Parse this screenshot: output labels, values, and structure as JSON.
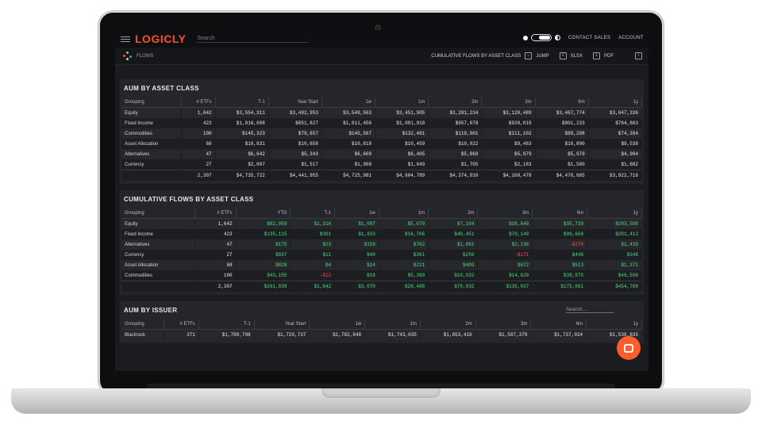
{
  "app": {
    "logo": "LOGICLY",
    "search_placeholder": "Search"
  },
  "topbar": {
    "contact_sales": "CONTACT SALES",
    "account": "ACCOUNT"
  },
  "subbar": {
    "page": "FLOWS",
    "section_select": "CUMULATIVE FLOWS BY ASSET CLASS",
    "jump": "JUMP",
    "xlsx": "XLSX",
    "pdf": "PDF"
  },
  "colors": {
    "accent": "#ff4d2a",
    "positive": "#4ee07b",
    "negative": "#ff4d4d"
  },
  "aum_asset": {
    "title": "AUM BY ASSET CLASS",
    "headers": [
      "Grouping",
      "# ETFs",
      "T-1",
      "Year Start",
      "1w",
      "1m",
      "2m",
      "3m",
      "6m",
      "1y"
    ],
    "rows": [
      [
        "Equity",
        "1,642",
        "$3,554,311",
        "$3,492,953",
        "$3,549,563",
        "$3,451,905",
        "$3,281,234",
        "$3,120,489",
        "$3,467,774",
        "$3,047,336"
      ],
      [
        "Fixed Income",
        "423",
        "$1,016,608",
        "$851,827",
        "$1,011,456",
        "$1,001,910",
        "$957,078",
        "$920,019",
        "$901,233",
        "$784,863"
      ],
      [
        "Commodities",
        "100",
        "$145,323",
        "$79,657",
        "$145,567",
        "$132,461",
        "$119,001",
        "$111,102",
        "$89,298",
        "$74,394"
      ],
      [
        "Asset Allocation",
        "68",
        "$10,831",
        "$10,658",
        "$10,818",
        "$10,459",
        "$10,022",
        "$9,463",
        "$10,800",
        "$9,538"
      ],
      [
        "Alternatives",
        "47",
        "$6,642",
        "$5,343",
        "$6,608",
        "$6,405",
        "$5,869",
        "$5,979",
        "$5,979",
        "$4,904"
      ],
      [
        "Currency",
        "27",
        "$2,007",
        "$1,517",
        "$1,968",
        "$1,649",
        "$1,705",
        "$2,183",
        "$1,580",
        "$1,682"
      ]
    ],
    "total": [
      "",
      "2,307",
      "$4,735,722",
      "$4,441,955",
      "$4,725,981",
      "$4,604,789",
      "$4,374,910",
      "$4,168,478",
      "$4,476,665",
      "$3,922,716"
    ]
  },
  "cum_flows": {
    "title": "CUMULATIVE FLOWS BY ASSET CLASS",
    "headers": [
      "Grouping",
      "# ETFs",
      "YTD",
      "T-1",
      "1w",
      "1m",
      "2m",
      "3m",
      "6m",
      "1y"
    ],
    "rows": [
      [
        "Equity",
        "1,642",
        "$82,059",
        "$1,316",
        "$1,007",
        "$5,070",
        "$7,104",
        "$38,640",
        "$35,730",
        "$203,598"
      ],
      [
        "Fixed Income",
        "423",
        "$135,115",
        "$301",
        "$1,833",
        "$16,706",
        "$49,451",
        "$79,140",
        "$99,668",
        "$201,413"
      ],
      [
        "Alternatives",
        "47",
        "$175",
        "$23",
        "$159",
        "$762",
        "$1,881",
        "$2,136",
        "-$270",
        "$1,439"
      ],
      [
        "Currency",
        "27",
        "$507",
        "$11",
        "$40",
        "$361",
        "$256",
        "-$171",
        "$446",
        "$348"
      ],
      [
        "Asset Allocation",
        "68",
        "$828",
        "$4",
        "$14",
        "$221",
        "$409",
        "$672",
        "$513",
        "$1,371"
      ],
      [
        "Commodities",
        "100",
        "$43,155",
        "-$12",
        "$18",
        "$5,360",
        "$10,932",
        "$14,620",
        "$38,975",
        "$46,598"
      ]
    ],
    "total": [
      "",
      "2,307",
      "$261,839",
      "$1,642",
      "$3,070",
      "$28,488",
      "$70,032",
      "$135,037",
      "$175,061",
      "$454,768"
    ]
  },
  "aum_issuer": {
    "title": "AUM BY ISSUER",
    "search_placeholder": "Search...",
    "headers": [
      "Grouping",
      "# ETFs",
      "T-1",
      "Year Start",
      "1w",
      "1m",
      "2m",
      "3m",
      "6m",
      "1y"
    ],
    "rows": [
      [
        "Blackrock",
        "371",
        "$1,780,798",
        "$1,729,737",
        "$1,782,848",
        "$1,743,035",
        "$1,653,416",
        "$1,587,379",
        "$1,737,024",
        "$1,538,835"
      ]
    ]
  }
}
